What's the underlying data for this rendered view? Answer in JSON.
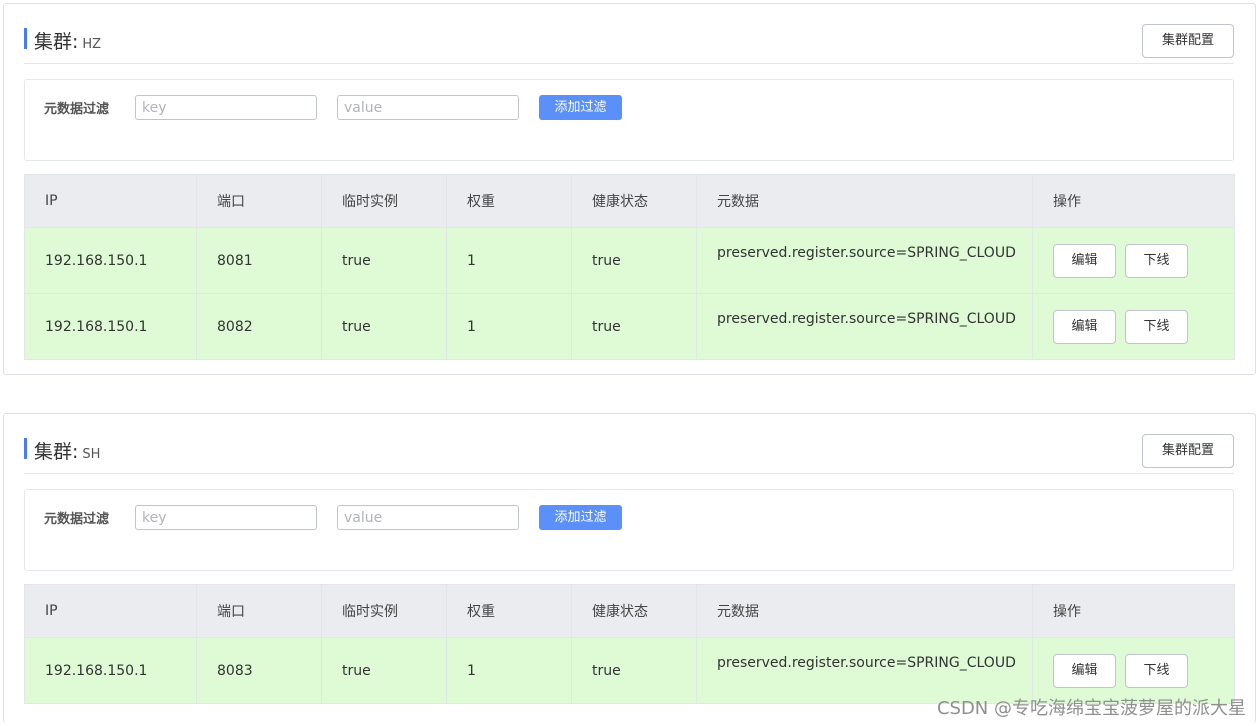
{
  "clusters": [
    {
      "title_label": "集群:",
      "name": "HZ",
      "config_button": "集群配置",
      "filter": {
        "label": "元数据过滤",
        "key_placeholder": "key",
        "value_placeholder": "value",
        "key_value": "",
        "value_value": "",
        "add_button": "添加过滤"
      },
      "columns": [
        "IP",
        "端口",
        "临时实例",
        "权重",
        "健康状态",
        "元数据",
        "操作"
      ],
      "rows": [
        {
          "ip": "192.168.150.1",
          "port": "8081",
          "ephemeral": "true",
          "weight": "1",
          "healthy": "true",
          "metadata": "preserved.register.source=SPRING_CLOUD",
          "edit": "编辑",
          "offline": "下线"
        },
        {
          "ip": "192.168.150.1",
          "port": "8082",
          "ephemeral": "true",
          "weight": "1",
          "healthy": "true",
          "metadata": "preserved.register.source=SPRING_CLOUD",
          "edit": "编辑",
          "offline": "下线"
        }
      ]
    },
    {
      "title_label": "集群:",
      "name": "SH",
      "config_button": "集群配置",
      "filter": {
        "label": "元数据过滤",
        "key_placeholder": "key",
        "value_placeholder": "value",
        "key_value": "",
        "value_value": "",
        "add_button": "添加过滤"
      },
      "columns": [
        "IP",
        "端口",
        "临时实例",
        "权重",
        "健康状态",
        "元数据",
        "操作"
      ],
      "rows": [
        {
          "ip": "192.168.150.1",
          "port": "8083",
          "ephemeral": "true",
          "weight": "1",
          "healthy": "true",
          "metadata": "preserved.register.source=SPRING_CLOUD",
          "edit": "编辑",
          "offline": "下线"
        }
      ]
    }
  ],
  "watermark": "CSDN @专吃海绵宝宝菠萝屋的派大星",
  "colors": {
    "accent": "#4a7cf6",
    "primary_button": "#5b8ff9",
    "healthy_row": "#defbd6",
    "table_header": "#ebecef"
  }
}
